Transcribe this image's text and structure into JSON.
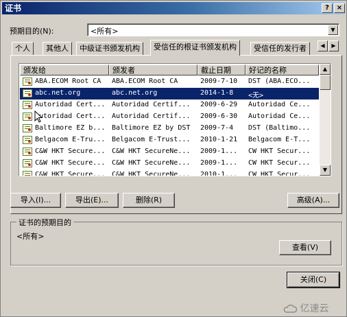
{
  "window": {
    "title": "证书"
  },
  "titlebar_buttons": {
    "help": "?",
    "close": "×"
  },
  "purpose": {
    "label": "预期目的(N):",
    "value": "<所有>"
  },
  "tabs": [
    {
      "label": "个人"
    },
    {
      "label": "其他人"
    },
    {
      "label": "中级证书颁发机构"
    },
    {
      "label": "受信任的根证书颁发机构"
    },
    {
      "label": "受信任的发行者"
    }
  ],
  "tab_scroll": {
    "left": "◀",
    "right": "▶"
  },
  "list": {
    "columns": [
      "颁发给",
      "颁发者",
      "截止日期",
      "好记的名称"
    ],
    "rows": [
      [
        "ABA.ECOM Root CA",
        "ABA.ECOM Root CA",
        "2009-7-10",
        "DST (ABA.ECO..."
      ],
      [
        "abc.net.org",
        "abc.net.org",
        "2014-1-8",
        "<无>"
      ],
      [
        "Autoridad Cert...",
        "Autoridad Certif...",
        "2009-6-29",
        "Autoridad Ce..."
      ],
      [
        "Autoridad Cert...",
        "Autoridad Certif...",
        "2009-6-30",
        "Autoridad Ce..."
      ],
      [
        "Baltimore EZ b...",
        "Baltimore EZ by DST",
        "2009-7-4",
        "DST (Baltimo..."
      ],
      [
        "Belgacom E-Tru...",
        "Belgacom E-Trust...",
        "2010-1-21",
        "Belgacom E-T..."
      ],
      [
        "C&W HKT Secure...",
        "C&W HKT SecureNe...",
        "2009-1...",
        "CW HKT Secur..."
      ],
      [
        "C&W HKT Secure...",
        "C&W HKT SecureNe...",
        "2009-1...",
        "CW HKT Secur..."
      ],
      [
        "C&W HKT Secure...",
        "C&W HKT SecureNe...",
        "2010-1...",
        "CW HKT Secur..."
      ]
    ],
    "selected_index": 1
  },
  "buttons": {
    "import": "导入(I)...",
    "export": "导出(E)...",
    "remove": "删除(R)",
    "advanced": "高级(A)...",
    "view": "查看(V)",
    "close": "关闭(C)"
  },
  "group": {
    "title": "证书的预期目的",
    "value": "<所有>"
  },
  "watermark": "亿速云",
  "icons": [
    "certificate-icon",
    "dropdown-arrow-icon",
    "scroll-up-icon",
    "scroll-down-icon",
    "help-icon",
    "close-icon",
    "cloud-logo-icon"
  ]
}
